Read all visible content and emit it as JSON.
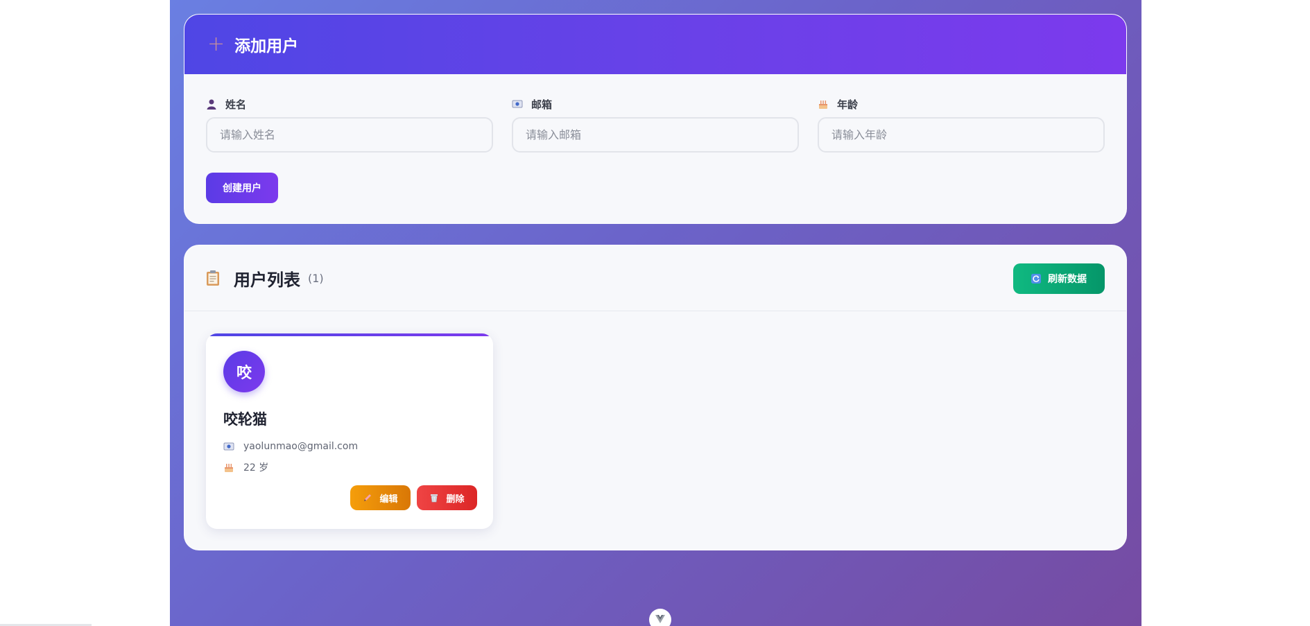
{
  "add_form": {
    "title": "添加用户",
    "fields": [
      {
        "label": "姓名",
        "placeholder": "请输入姓名",
        "icon": "person-icon"
      },
      {
        "label": "邮箱",
        "placeholder": "请输入邮箱",
        "icon": "mail-icon"
      },
      {
        "label": "年龄",
        "placeholder": "请输入年龄",
        "icon": "cake-icon"
      }
    ],
    "submit_label": "创建用户"
  },
  "user_list": {
    "title": "用户列表",
    "count": "(1)",
    "refresh_label": "刷新数据",
    "users": [
      {
        "avatar_char": "咬",
        "name": "咬轮猫",
        "email": "yaolunmao@gmail.com",
        "age": "22 岁",
        "edit_label": "编辑",
        "delete_label": "删除"
      }
    ]
  },
  "colors": {
    "primary": "#5b3be6",
    "success": "#10b981",
    "warning": "#f59e0b",
    "danger": "#ef4444"
  }
}
